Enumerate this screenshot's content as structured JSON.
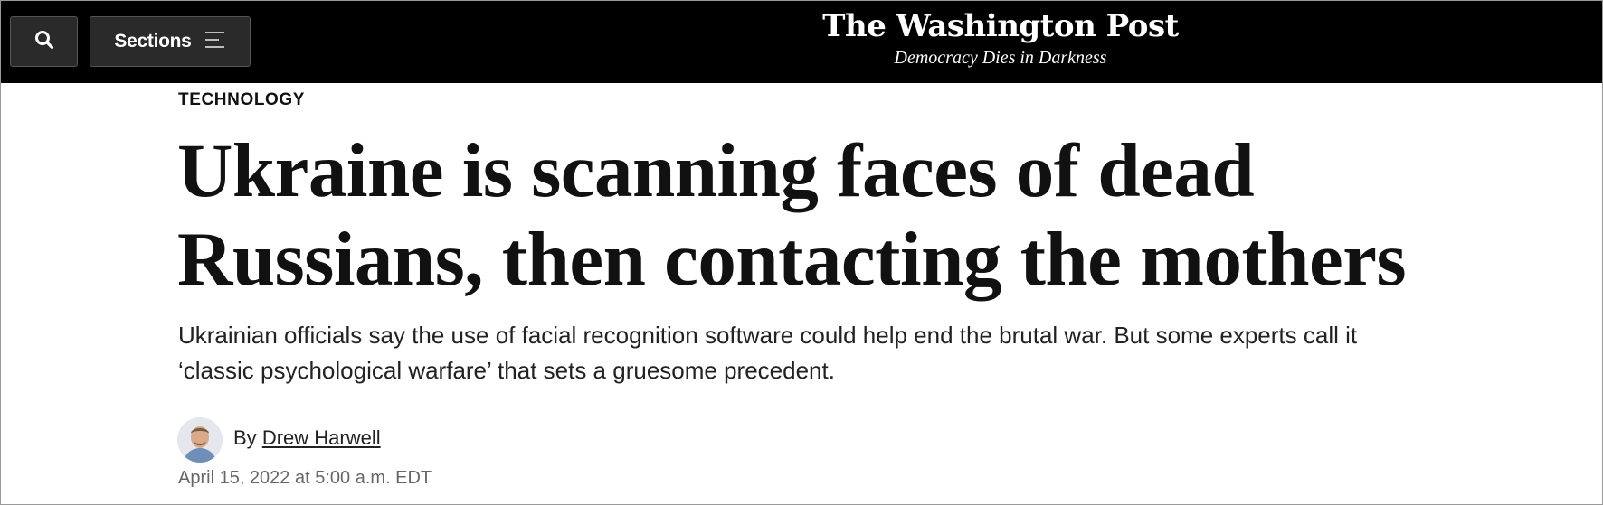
{
  "header": {
    "search_icon": "search-icon",
    "sections_label": "Sections",
    "menu_icon": "hamburger-menu-icon",
    "logo_text": "The Washington Post",
    "tagline": "Democracy Dies in Darkness"
  },
  "article": {
    "kicker": "TECHNOLOGY",
    "headline_line1": "Ukraine is scanning faces of dead",
    "headline_line2": "Russians, then contacting the mothers",
    "dek_line1": "Ukrainian officials say the use of facial recognition software could help end the brutal war. But some experts call it",
    "dek_line2": "‘classic psychological warfare’ that sets a gruesome precedent.",
    "byline_prefix": "By",
    "author": "Drew Harwell",
    "timestamp": "April 15, 2022 at 5:00 a.m. EDT"
  },
  "colors": {
    "header_bg": "#000000",
    "button_bg": "#2a2a2a",
    "text": "#111111",
    "muted": "#666666"
  }
}
